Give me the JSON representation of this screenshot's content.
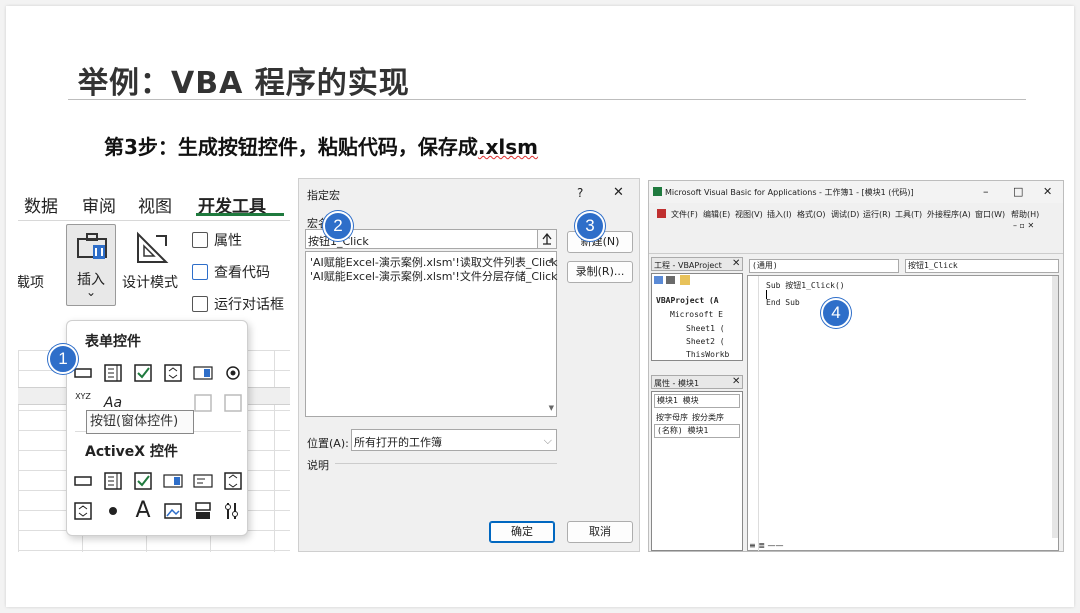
{
  "slide": {
    "title": "举例：VBA 程序的实现",
    "subtitle_prefix": "第3步：生成按钮控件，粘贴代码，保存成",
    "subtitle_ext": ".xlsm"
  },
  "excel": {
    "tabs": [
      "数据",
      "审阅",
      "视图",
      "开发工具"
    ],
    "left_partial_label": "载项",
    "insert_label": "插入",
    "insert_caret": "⌄",
    "design_mode_label": "设计模式",
    "properties_label": "属性",
    "view_code_label": "查看代码",
    "run_dialog_label": "运行对话框",
    "form_controls_heading": "表单控件",
    "activex_heading": "ActiveX 控件",
    "tooltip": "按钮(窗体控件)",
    "badge": "1",
    "xyz_label": "XYZ",
    "aa_label": "Aa"
  },
  "macro_dialog": {
    "title": "指定宏",
    "help": "?",
    "close": "✕",
    "macro_name_label": "宏名",
    "macro_name_value": "按钮1_Click",
    "list_items": [
      "'AI赋能Excel-演示案例.xlsm'!读取文件列表_Click",
      "'AI赋能Excel-演示案例.xlsm'!文件分层存储_Click"
    ],
    "new_button": "新建(N)",
    "record_button": "录制(R)...",
    "location_label": "位置(A):",
    "location_value": "所有打开的工作簿",
    "description_label": "说明",
    "ok_button": "确定",
    "cancel_button": "取消",
    "badge_2": "2",
    "badge_3": "3"
  },
  "vba": {
    "window_title": "Microsoft Visual Basic for Applications - 工作簿1 - [模块1 (代码)]",
    "menus": [
      "文件(F)",
      "编辑(E)",
      "视图(V)",
      "插入(I)",
      "格式(O)",
      "调试(D)",
      "运行(R)",
      "工具(T)",
      "外接程序(A)",
      "窗口(W)",
      "帮助(H)"
    ],
    "project_pane_title": "工程 - VBAProject",
    "tree": [
      "VBAProject (A",
      "Microsoft E",
      "Sheet1 (",
      "Sheet2 (",
      "ThisWorkb"
    ],
    "props_pane_title": "属性 - 模块1",
    "props_combo": "模块1 模块",
    "props_tabs": [
      "按字母序",
      "按分类序"
    ],
    "props_row": "(名称) 模块1",
    "object_combo": "(通用)",
    "proc_combo": "按钮1_Click",
    "code_lines": [
      "Sub 按钮1_Click()",
      "End Sub"
    ],
    "badge": "4"
  }
}
